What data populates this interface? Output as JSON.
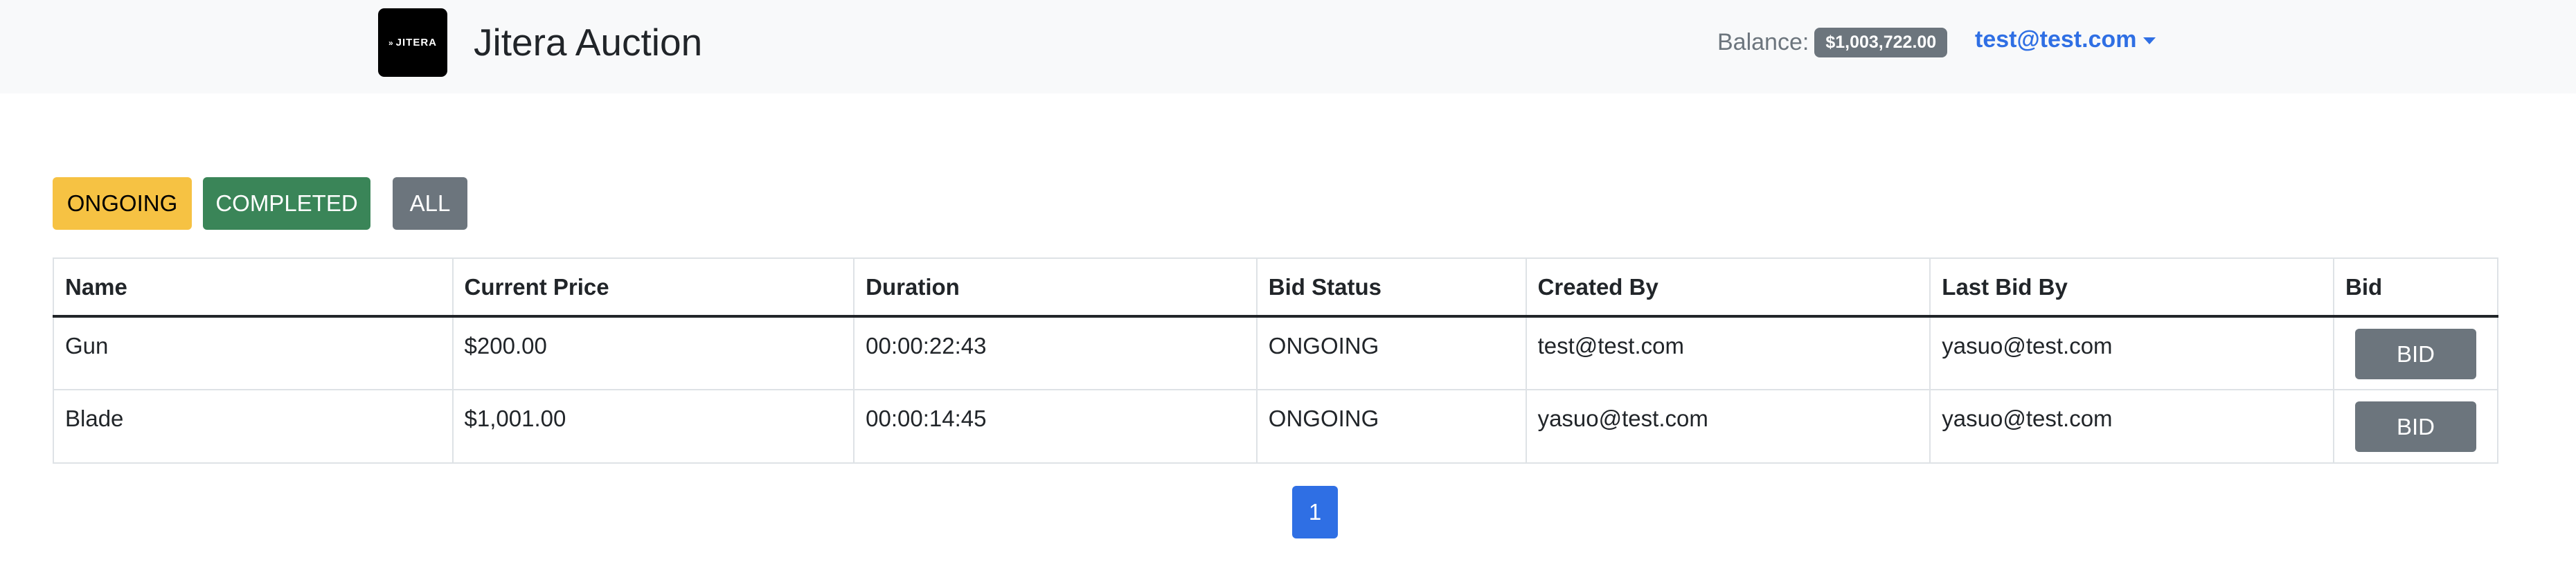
{
  "navbar": {
    "logo_text": "JITERA",
    "logo_mark": "»",
    "title": "Jitera Auction",
    "balance_label": "Balance:",
    "balance_value": "$1,003,722.00",
    "user_email": "test@test.com"
  },
  "filters": {
    "ongoing_label": "ONGOING",
    "completed_label": "COMPLETED",
    "all_label": "ALL"
  },
  "table": {
    "headers": [
      "Name",
      "Current Price",
      "Duration",
      "Bid Status",
      "Created By",
      "Last Bid By",
      "Bid"
    ],
    "rows": [
      {
        "name": "Gun",
        "current_price": "$200.00",
        "duration": "00:00:22:43",
        "bid_status": "ONGOING",
        "created_by": "test@test.com",
        "last_bid_by": "yasuo@test.com",
        "bid_label": "BID"
      },
      {
        "name": "Blade",
        "current_price": "$1,001.00",
        "duration": "00:00:14:45",
        "bid_status": "ONGOING",
        "created_by": "yasuo@test.com",
        "last_bid_by": "yasuo@test.com",
        "bid_label": "BID"
      }
    ]
  },
  "pagination": {
    "current_page": "1"
  },
  "colors": {
    "navbar_bg": "#f8f9fa",
    "ongoing": "#f6c243",
    "completed": "#3a8558",
    "secondary": "#6c757d",
    "primary": "#2f6fe4",
    "status_ongoing_text": "#f2a127"
  }
}
